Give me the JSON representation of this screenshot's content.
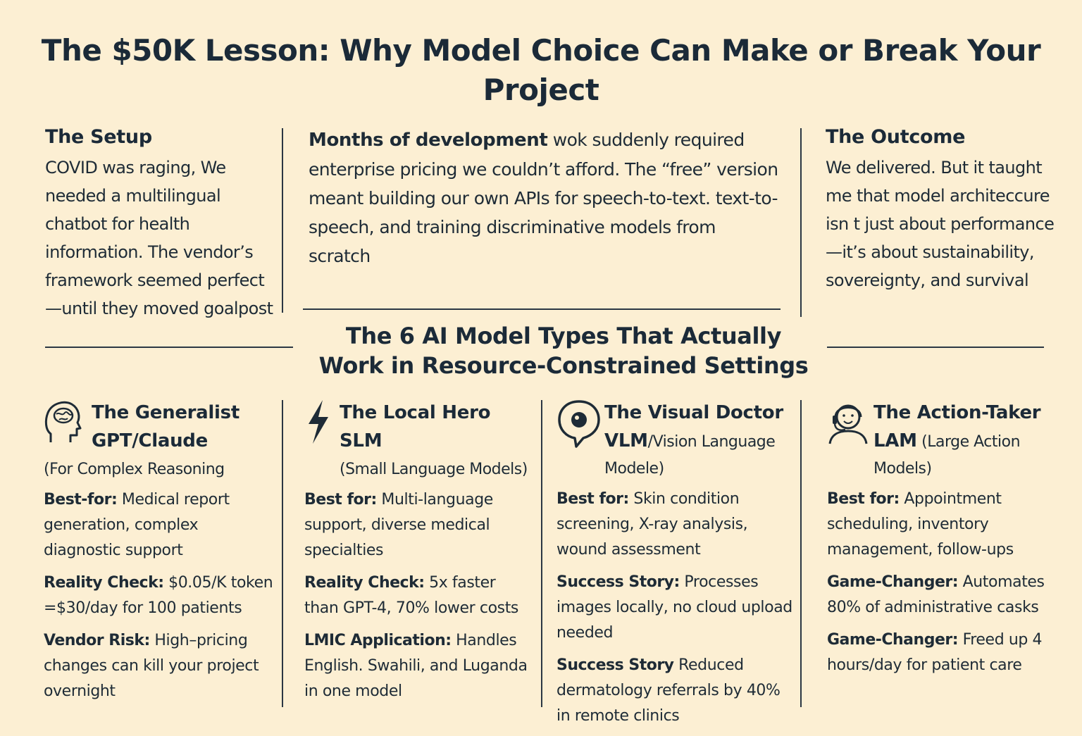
{
  "title": "The $50K Lesson: Why Model Choice Can Make or Break Your Project",
  "setup": {
    "heading": "The Setup",
    "text": "COVID was raging, We needed a multilingual chatbot for health information. The vendor’s framework seemed perfect —until they moved goalpost"
  },
  "middle": {
    "bold_lead": "Months of development",
    "text": " wok suddenly required enterprise pricing we couldn’t afford. The “free” version meant building our own APIs for speech-to-text. text-to-speech, and training discriminative models from scratch"
  },
  "outcome": {
    "heading": "The Outcome",
    "text": "We delivered. But it taught me that model architeccure isn t just about performance—it’s about sustainability, sovereignty, and survival"
  },
  "section_title": "The 6 AI Model Types That Actually Work in Resource-Constrained Settings",
  "cards": [
    {
      "title_line1": "The Generalist",
      "title_line2": "GPT/Claude",
      "title_extra": "",
      "subtitle": "(For Complex Reasoning",
      "icon": "brain-head-icon",
      "items": [
        {
          "label": "Best-for:",
          "text": " Medical report generation, complex diagnostic support"
        },
        {
          "label": "Reality Check:",
          "text": " $0.05/K token =$30/day for 100 patients"
        },
        {
          "label": "Vendor Risk:",
          "text": " High–pricing changes can kill your project overnight"
        }
      ]
    },
    {
      "title_line1": "The Local Hero",
      "title_line2": "SLM",
      "title_extra": "",
      "subtitle": "(Small Language Models)",
      "icon": "lightning-bolt-icon",
      "items": [
        {
          "label": "Best for:",
          "text": " Multi-language support, diverse medical specialties"
        },
        {
          "label": "Reality Check:",
          "text": " 5x faster than GPT-4, 70% lower costs"
        },
        {
          "label": "LMIC Application:",
          "text": " Handles English. Swahili, and Luganda in one model"
        }
      ]
    },
    {
      "title_line1": "The Visual Doctor",
      "title_line2": "VLM",
      "title_extra": "/Vision Language",
      "subtitle": "Modele)",
      "icon": "eye-speech-bubble-icon",
      "items": [
        {
          "label": "Best for:",
          "text": " Skin condition screening, X-ray analysis, wound assessment"
        },
        {
          "label": "Success Story:",
          "text": " Processes images locally, no cloud upload needed"
        },
        {
          "label": "Success Story",
          "text": "  Reduced dermatology referrals by 40% in remote clinics"
        }
      ]
    },
    {
      "title_line1": "The Action-Taker",
      "title_line2": "LAM",
      "title_extra": " (Large Action",
      "subtitle": "Models)",
      "icon": "headset-agent-icon",
      "items": [
        {
          "label": "Best for:",
          "text": " Appointment scheduling, inventory management, follow-ups"
        },
        {
          "label": "Game-Changer:",
          "text": " Automates 80% of administrative casks"
        },
        {
          "label": "Game-Changer:",
          "text": " Freed up 4 hours/day for patient care"
        }
      ]
    }
  ]
}
